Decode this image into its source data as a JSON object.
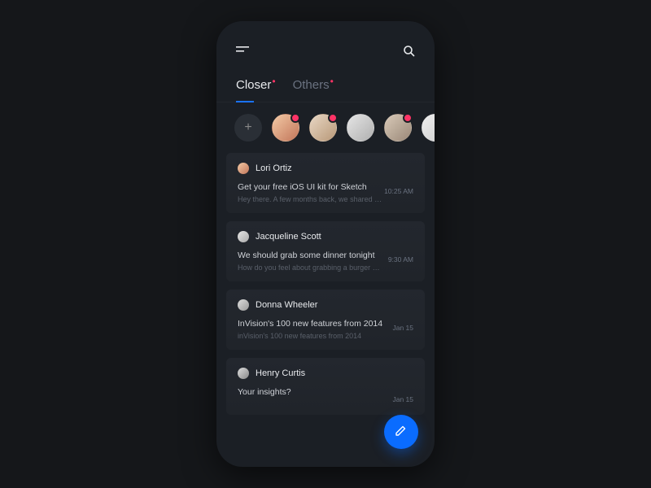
{
  "tabs": [
    {
      "label": "Closer",
      "active": true,
      "hasDot": true
    },
    {
      "label": "Others",
      "active": false,
      "hasDot": true
    }
  ],
  "stories": {
    "add_label": "+",
    "items": [
      {
        "hasBadge": true
      },
      {
        "hasBadge": true
      },
      {
        "hasBadge": false
      },
      {
        "hasBadge": true
      },
      {
        "hasBadge": false
      }
    ]
  },
  "messages": [
    {
      "name": "Lori Ortiz",
      "subject": "Get your free iOS UI kit for Sketch",
      "preview": "Hey there. A few months back, we shared …",
      "time": "10:25 AM"
    },
    {
      "name": "Jacqueline Scott",
      "subject": "We should grab some dinner tonight",
      "preview": "How do you feel about grabbing a burger …",
      "time": "9:30 AM"
    },
    {
      "name": "Donna Wheeler",
      "subject": "InVision's 100 new features from 2014",
      "preview": "inVision's 100 new features from 2014",
      "time": "Jan 15"
    },
    {
      "name": "Henry Curtis",
      "subject": "Your insights?",
      "preview": "",
      "time": "Jan 15"
    }
  ],
  "colors": {
    "accent": "#0a6cff",
    "danger": "#ff3366"
  }
}
